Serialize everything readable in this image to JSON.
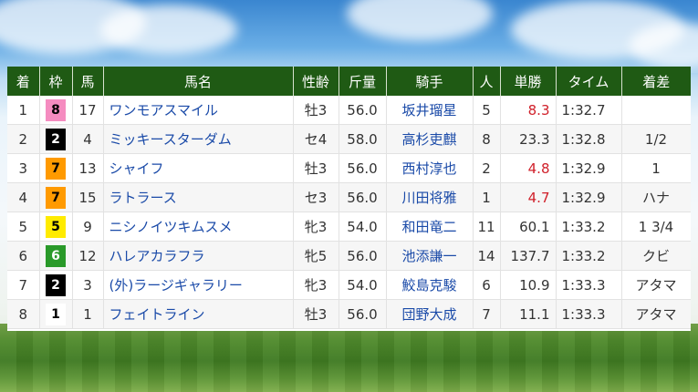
{
  "headers": [
    "着",
    "枠",
    "馬",
    "馬名",
    "性齢",
    "斤量",
    "騎手",
    "人",
    "単勝",
    "タイム",
    "着差"
  ],
  "rows": [
    {
      "rank": "1",
      "frame": "8",
      "num": "17",
      "horse": "ワンモアスマイル",
      "sex_age": "牡3",
      "weight": "56.0",
      "jockey": "坂井瑠星",
      "pop": "5",
      "odds": "8.3",
      "odds_highlight": true,
      "time": "1:32.7",
      "margin": ""
    },
    {
      "rank": "2",
      "frame": "2",
      "num": "4",
      "horse": "ミッキースターダム",
      "sex_age": "セ4",
      "weight": "58.0",
      "jockey": "高杉吏麒",
      "pop": "8",
      "odds": "23.3",
      "odds_highlight": false,
      "time": "1:32.8",
      "margin": "1/2"
    },
    {
      "rank": "3",
      "frame": "7",
      "num": "13",
      "horse": "シャイフ",
      "sex_age": "牡3",
      "weight": "56.0",
      "jockey": "西村淳也",
      "pop": "2",
      "odds": "4.8",
      "odds_highlight": true,
      "time": "1:32.9",
      "margin": "1"
    },
    {
      "rank": "4",
      "frame": "7",
      "num": "15",
      "horse": "ラトラース",
      "sex_age": "セ3",
      "weight": "56.0",
      "jockey": "川田将雅",
      "pop": "1",
      "odds": "4.7",
      "odds_highlight": true,
      "time": "1:32.9",
      "margin": "ハナ"
    },
    {
      "rank": "5",
      "frame": "5",
      "num": "9",
      "horse": "ニシノイツキムスメ",
      "sex_age": "牝3",
      "weight": "54.0",
      "jockey": "和田竜二",
      "pop": "11",
      "odds": "60.1",
      "odds_highlight": false,
      "time": "1:33.2",
      "margin": "1 3/4"
    },
    {
      "rank": "6",
      "frame": "6",
      "num": "12",
      "horse": "ハレアカラフラ",
      "sex_age": "牝5",
      "weight": "56.0",
      "jockey": "池添謙一",
      "pop": "14",
      "odds": "137.7",
      "odds_highlight": false,
      "time": "1:33.2",
      "margin": "クビ"
    },
    {
      "rank": "7",
      "frame": "2",
      "num": "3",
      "horse": "(外)ラージギャラリー",
      "sex_age": "牝3",
      "weight": "54.0",
      "jockey": "鮫島克駿",
      "pop": "6",
      "odds": "10.9",
      "odds_highlight": false,
      "time": "1:33.3",
      "margin": "アタマ"
    },
    {
      "rank": "8",
      "frame": "1",
      "num": "1",
      "horse": "フェイトライン",
      "sex_age": "牡3",
      "weight": "56.0",
      "jockey": "団野大成",
      "pop": "7",
      "odds": "11.1",
      "odds_highlight": false,
      "time": "1:33.3",
      "margin": "アタマ"
    }
  ],
  "colors": {
    "header_bg": "#1f5a14",
    "link": "#1a4aa8",
    "odds_highlight": "#d0202a",
    "frame_1": "#ffffff",
    "frame_2": "#000000",
    "frame_5": "#ffeb00",
    "frame_6": "#2a9a2a",
    "frame_7": "#ff9a00",
    "frame_8": "#f58cc0"
  }
}
